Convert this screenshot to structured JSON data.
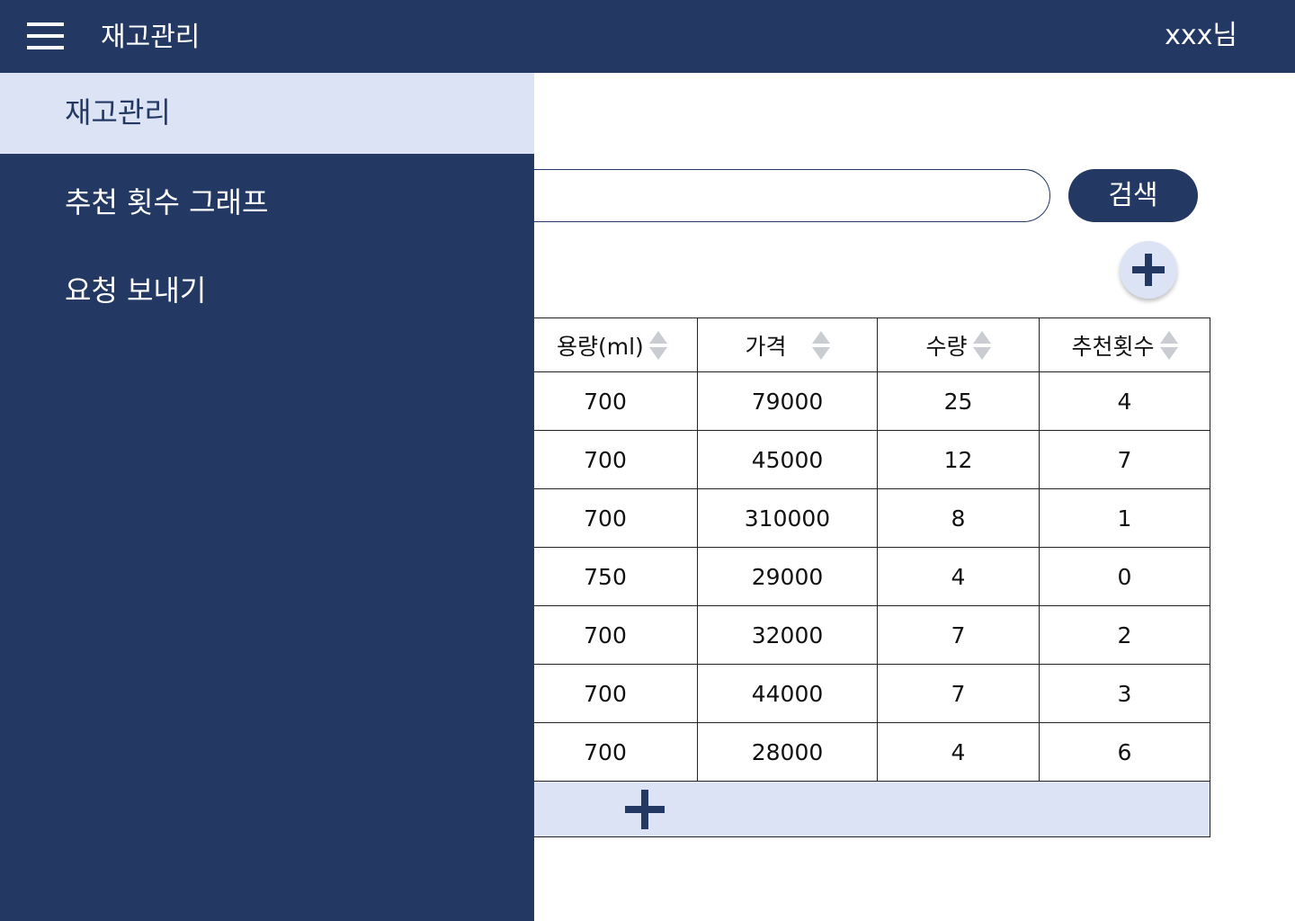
{
  "header": {
    "menu_icon": "hamburger-menu-icon",
    "title": "재고관리",
    "user": "xxx님"
  },
  "drawer": {
    "items": [
      {
        "label": "재고관리",
        "active": true
      },
      {
        "label": "추천 횟수 그래프",
        "active": false
      },
      {
        "label": "요청 보내기",
        "active": false
      }
    ]
  },
  "search": {
    "value": "",
    "button_label": "검색"
  },
  "add_item_button": {
    "icon": "plus-icon"
  },
  "table": {
    "columns": [
      {
        "label": "용량(ml)",
        "sort_icon": "sort-arrows-icon"
      },
      {
        "label": "가격",
        "sort_icon": "sort-arrows-icon"
      },
      {
        "label": "수량",
        "sort_icon": "sort-arrows-icon"
      },
      {
        "label": "추천횟수",
        "sort_icon": "sort-arrows-icon"
      }
    ],
    "rows": [
      [
        "700",
        "79000",
        "25",
        "4"
      ],
      [
        "700",
        "45000",
        "12",
        "7"
      ],
      [
        "700",
        "310000",
        "8",
        "1"
      ],
      [
        "750",
        "29000",
        "4",
        "0"
      ],
      [
        "700",
        "32000",
        "7",
        "2"
      ],
      [
        "700",
        "44000",
        "7",
        "3"
      ],
      [
        "700",
        "28000",
        "4",
        "6"
      ]
    ],
    "add_row_icon": "plus-icon"
  },
  "colors": {
    "primary": "#233964",
    "light_accent": "#dbe3f4",
    "sort_arrow": "#c9ccd1"
  }
}
